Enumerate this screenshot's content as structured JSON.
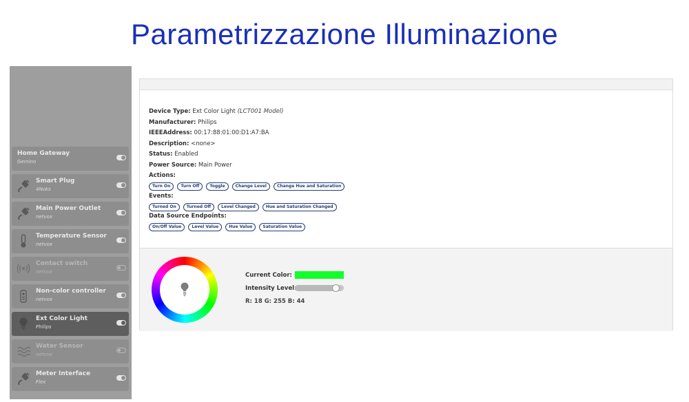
{
  "page_title": "Parametrizzazione Illuminazione",
  "sidebar": {
    "devices": [
      {
        "name": "Home Gateway",
        "vendor": "Gemino",
        "icon": "",
        "enabled": true,
        "selected": false
      },
      {
        "name": "Smart Plug",
        "vendor": "4Noks",
        "icon": "plug-icon",
        "enabled": true,
        "selected": false
      },
      {
        "name": "Main Power Outlet",
        "vendor": "netvox",
        "icon": "plug-icon",
        "enabled": true,
        "selected": false
      },
      {
        "name": "Temperature Sensor",
        "vendor": "netvox",
        "icon": "thermometer-icon",
        "enabled": true,
        "selected": false
      },
      {
        "name": "Contact switch",
        "vendor": "netvox",
        "icon": "wireless-icon",
        "enabled": false,
        "selected": false
      },
      {
        "name": "Non-color controller",
        "vendor": "netvox",
        "icon": "remote-icon",
        "enabled": true,
        "selected": false
      },
      {
        "name": "Ext Color Light",
        "vendor": "Philips",
        "icon": "bulb-icon",
        "enabled": true,
        "selected": true
      },
      {
        "name": "Water Sensor",
        "vendor": "netvox",
        "icon": "water-icon",
        "enabled": false,
        "selected": false
      },
      {
        "name": "Meter Interface",
        "vendor": "Flex",
        "icon": "plug-icon",
        "enabled": true,
        "selected": false
      }
    ]
  },
  "device_info": {
    "device_type_label": "Device Type:",
    "device_type_value": "Ext Color Light",
    "device_model": "(LCT001 Model)",
    "manufacturer_label": "Manufacturer:",
    "manufacturer_value": "Philips",
    "ieee_label": "IEEEAddress:",
    "ieee_value": "00:17:88:01:00:D1:A7:BA",
    "description_label": "Description:",
    "description_value": "<none>",
    "status_label": "Status:",
    "status_value": "Enabled",
    "power_label": "Power Source:",
    "power_value": "Main Power",
    "actions_label": "Actions:",
    "actions": [
      "Turn On",
      "Turn Off",
      "Toggle",
      "Change Level",
      "Change Hue and Saturation"
    ],
    "events_label": "Events:",
    "events": [
      "Turned On",
      "Turned Off",
      "Level Changed",
      "Hue and Saturation Changed"
    ],
    "endpoints_label": "Data Source Endpoints:",
    "endpoints": [
      "On/Off Value",
      "Level Value",
      "Hue Value",
      "Saturation Value"
    ]
  },
  "controls": {
    "current_color_label": "Current Color:",
    "current_color": "#12ff2c",
    "intensity_label": "Intensity Level:",
    "intensity_level": 0.9,
    "rgb_text": "R: 18 G: 255 B: 44"
  },
  "colors": {
    "title": "#1a2fb8",
    "pill_border": "#243e73",
    "sidebar_bg": "#9e9e9e",
    "sidebar_selected": "#5e5e5e"
  }
}
